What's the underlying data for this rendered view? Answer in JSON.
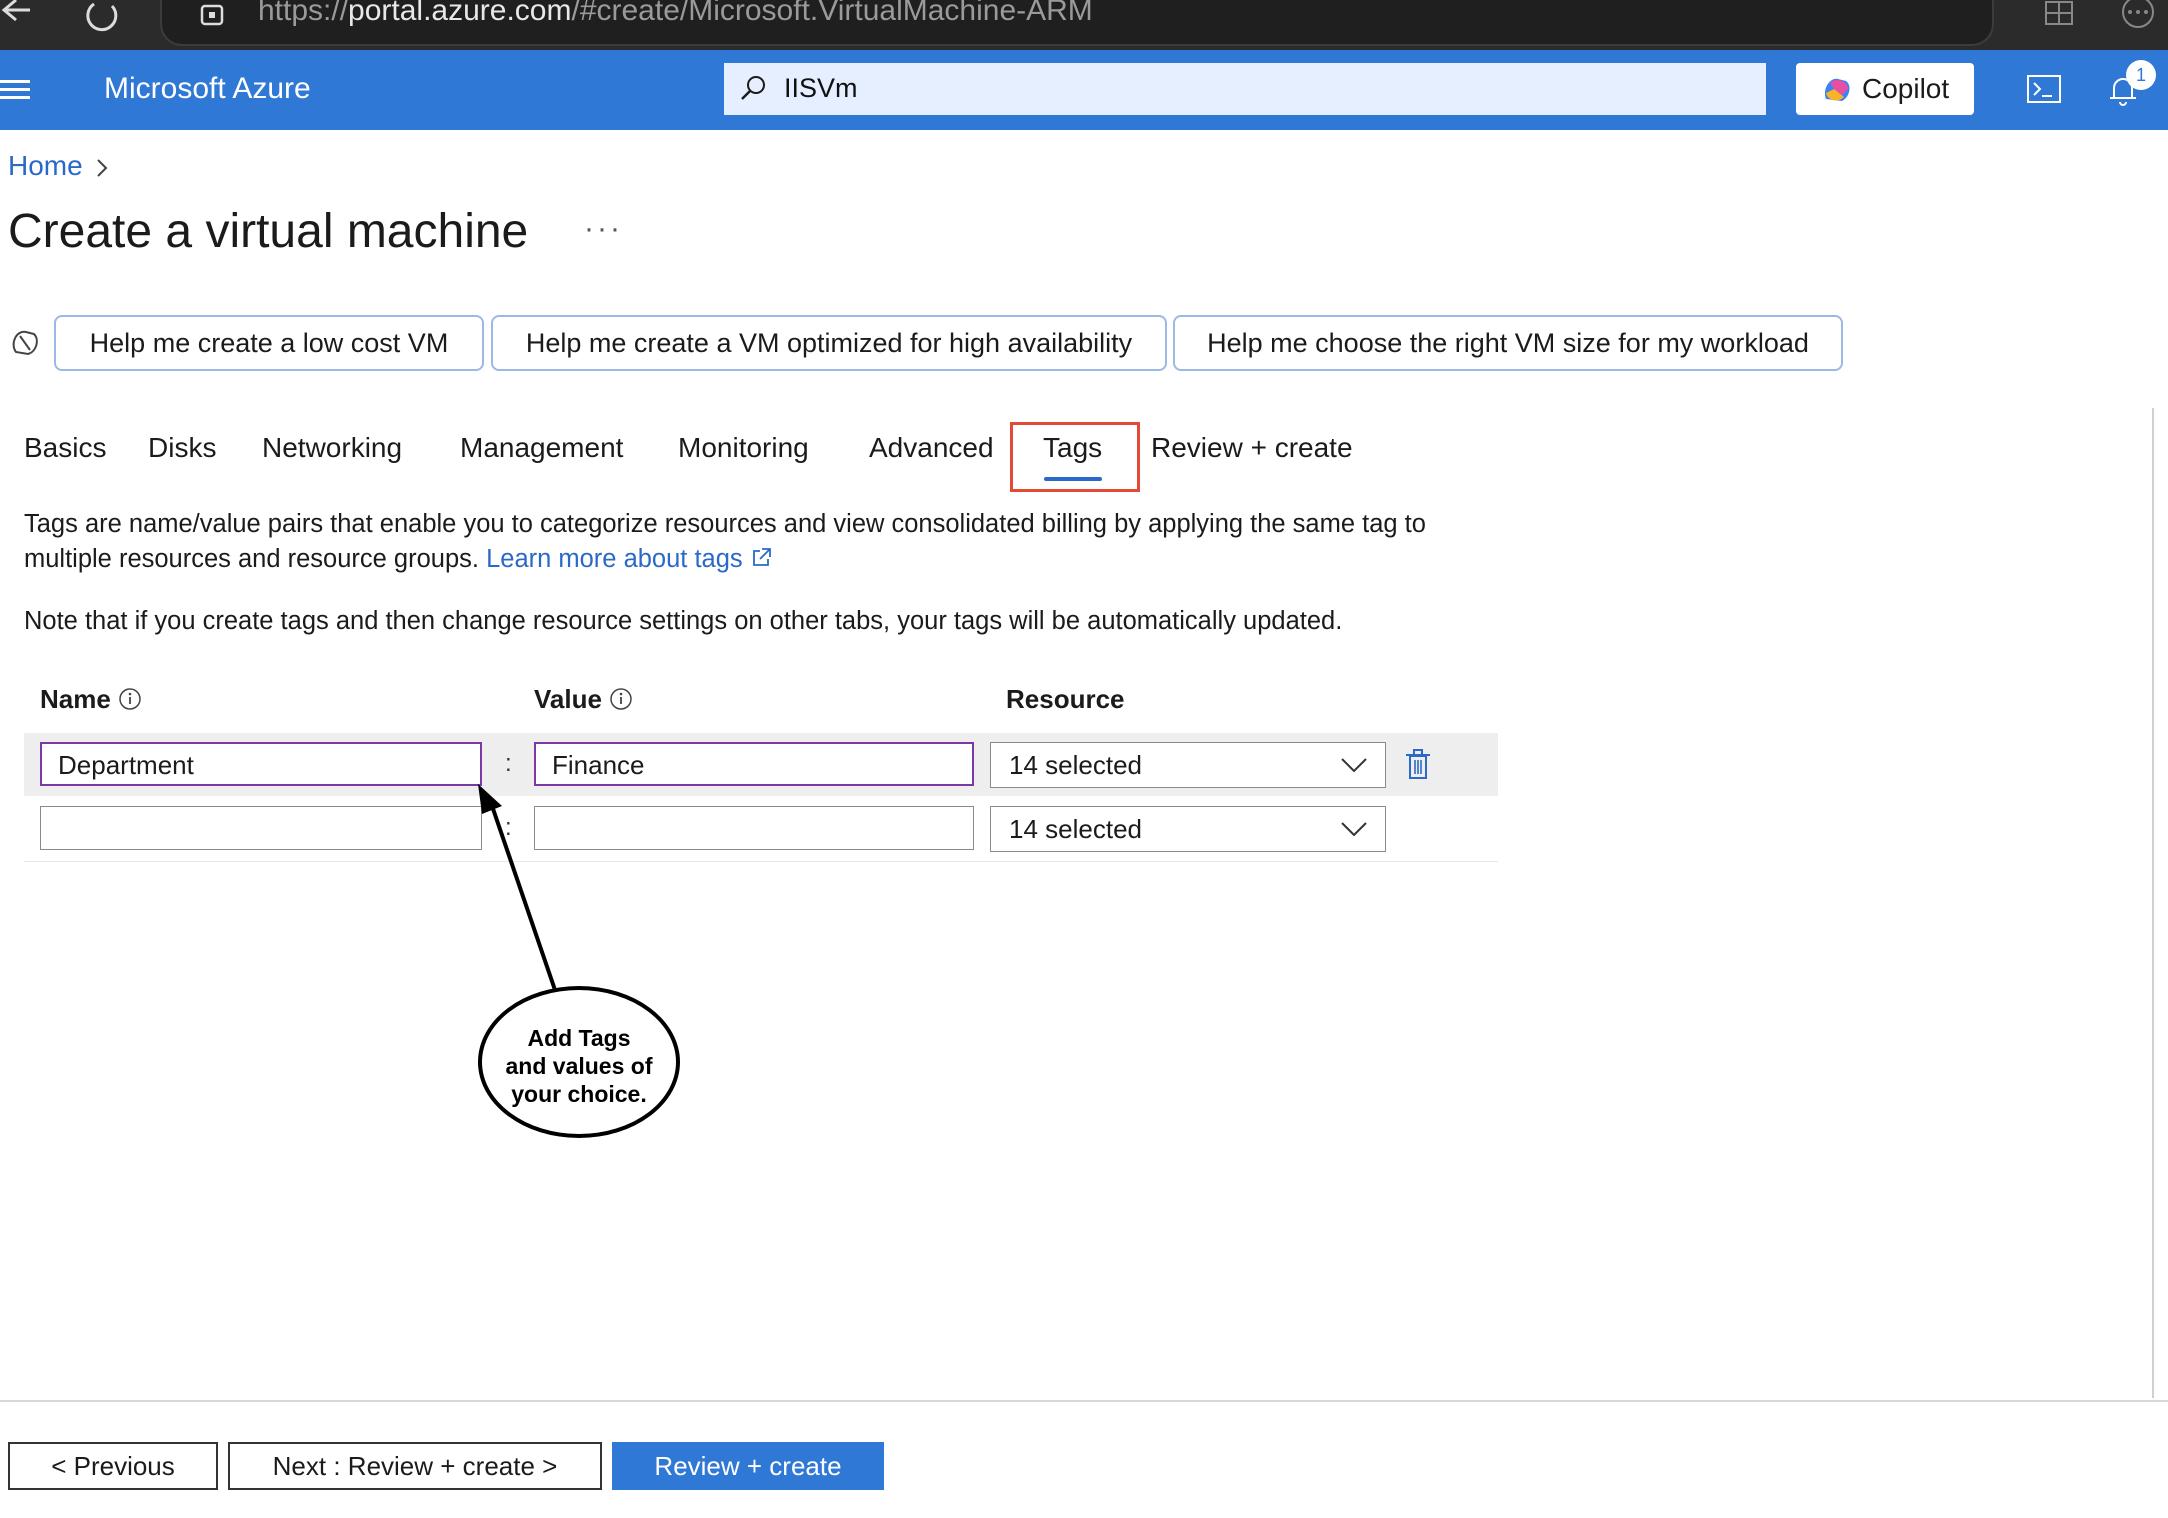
{
  "browser": {
    "url_prefix": "https://",
    "url_domain": "portal.azure.com",
    "url_path": "/#create/Microsoft.VirtualMachine-ARM"
  },
  "header": {
    "brand": "Microsoft Azure",
    "search_value": "IISVm",
    "copilot_label": "Copilot",
    "notification_count": "1"
  },
  "breadcrumb": {
    "home": "Home"
  },
  "page": {
    "title": "Create a virtual machine",
    "more": "···"
  },
  "helpers": [
    "Help me create a low cost VM",
    "Help me create a VM optimized for high availability",
    "Help me choose the right VM size for my workload"
  ],
  "tabs": [
    "Basics",
    "Disks",
    "Networking",
    "Management",
    "Monitoring",
    "Advanced",
    "Tags",
    "Review + create"
  ],
  "active_tab": "Tags",
  "description": {
    "line1": "Tags are name/value pairs that enable you to categorize resources and view consolidated billing by applying the same tag to",
    "line2": "multiple resources and resource groups.",
    "learn_more": "Learn more about tags",
    "note": "Note that if you create tags and then change resource settings on other tabs, your tags will be automatically updated."
  },
  "table": {
    "headers": {
      "name": "Name",
      "value": "Value",
      "resource": "Resource"
    },
    "separator": ":",
    "rows": [
      {
        "name": "Department",
        "value": "Finance",
        "resource": "14 selected"
      },
      {
        "name": "",
        "value": "",
        "resource": "14 selected"
      }
    ]
  },
  "annotation": {
    "line1": "Add Tags",
    "line2": "and values of",
    "line3": "your choice."
  },
  "footer": {
    "previous": "< Previous",
    "next": "Next : Review + create >",
    "review": "Review + create"
  },
  "colors": {
    "azure_blue": "#2f78d6",
    "link_blue": "#2a69c8",
    "highlight_red": "#e34a35",
    "focus_purple": "#7a3aa6"
  }
}
